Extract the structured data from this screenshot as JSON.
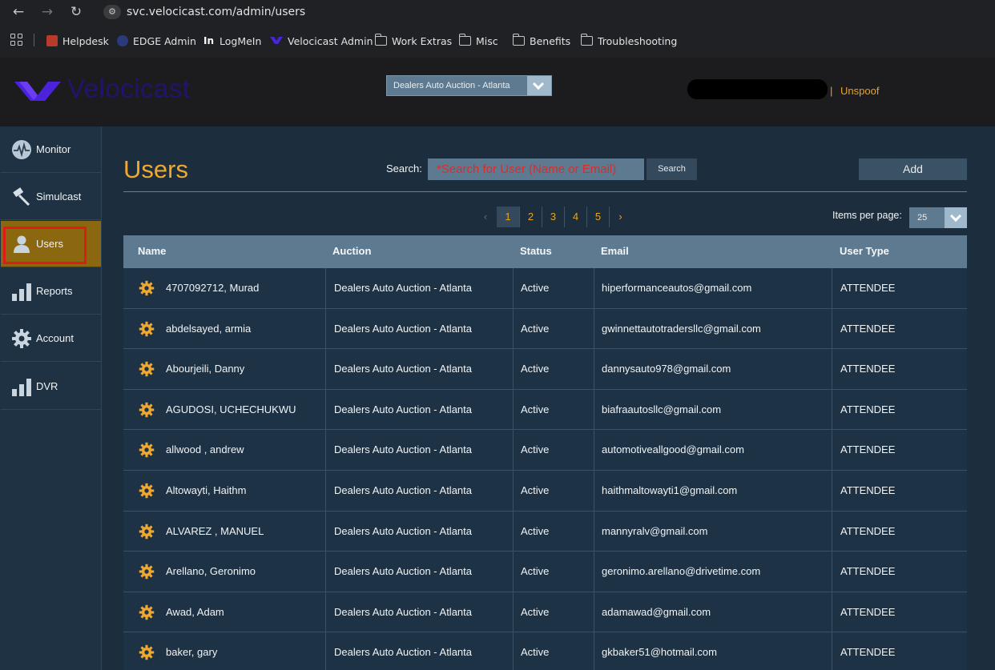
{
  "browser": {
    "url": "svc.velocicast.com/admin/users",
    "bookmarks": [
      {
        "label": "Helpdesk"
      },
      {
        "label": "EDGE Admin"
      },
      {
        "label": "LogMeIn"
      },
      {
        "label": "Velocicast Admin"
      },
      {
        "label": "Work Extras"
      },
      {
        "label": "Misc"
      },
      {
        "label": "Benefits"
      },
      {
        "label": "Troubleshooting"
      }
    ]
  },
  "header": {
    "logo_text": "Velocicast",
    "auction_selected": "Dealers Auto Auction - Atlanta",
    "separator": "|",
    "unspoof_label": "Unspoof"
  },
  "sidebar": {
    "items": [
      {
        "label": "Monitor",
        "icon": "monitor-icon"
      },
      {
        "label": "Simulcast",
        "icon": "gavel-icon"
      },
      {
        "label": "Users",
        "icon": "user-icon",
        "active": true
      },
      {
        "label": "Reports",
        "icon": "bar-chart-icon"
      },
      {
        "label": "Account",
        "icon": "gear-icon"
      },
      {
        "label": "DVR",
        "icon": "bar-chart-icon"
      }
    ]
  },
  "main": {
    "title": "Users",
    "search_label": "Search:",
    "search_placeholder": "*Search for User (Name or Email)",
    "search_button": "Search",
    "add_button": "Add",
    "pagination": {
      "prev": "‹",
      "pages": [
        "1",
        "2",
        "3",
        "4",
        "5"
      ],
      "current": "1",
      "next": "›"
    },
    "items_per_page_label": "Items per page:",
    "items_per_page_value": "25"
  },
  "table": {
    "columns": [
      "Name",
      "Auction",
      "Status",
      "Email",
      "User Type"
    ],
    "rows": [
      {
        "name": "4707092712, Murad",
        "auction": "Dealers Auto Auction - Atlanta",
        "status": "Active",
        "email": "hiperformanceautos@gmail.com",
        "type": "ATTENDEE"
      },
      {
        "name": "abdelsayed, armia",
        "auction": "Dealers Auto Auction - Atlanta",
        "status": "Active",
        "email": "gwinnettautotradersllc@gmail.com",
        "type": "ATTENDEE"
      },
      {
        "name": "Abourjeili, Danny",
        "auction": "Dealers Auto Auction - Atlanta",
        "status": "Active",
        "email": "dannysauto978@gmail.com",
        "type": "ATTENDEE"
      },
      {
        "name": "AGUDOSI, UCHECHUKWU",
        "auction": "Dealers Auto Auction - Atlanta",
        "status": "Active",
        "email": "biafraautosllc@gmail.com",
        "type": "ATTENDEE"
      },
      {
        "name": "allwood , andrew",
        "auction": "Dealers Auto Auction - Atlanta",
        "status": "Active",
        "email": "automotiveallgood@gmail.com",
        "type": "ATTENDEE"
      },
      {
        "name": "Altowayti, Haithm",
        "auction": "Dealers Auto Auction - Atlanta",
        "status": "Active",
        "email": "haithmaltowayti1@gmail.com",
        "type": "ATTENDEE"
      },
      {
        "name": "ALVAREZ , MANUEL",
        "auction": "Dealers Auto Auction - Atlanta",
        "status": "Active",
        "email": "mannyralv@gmail.com",
        "type": "ATTENDEE"
      },
      {
        "name": "Arellano, Geronimo",
        "auction": "Dealers Auto Auction - Atlanta",
        "status": "Active",
        "email": "geronimo.arellano@drivetime.com",
        "type": "ATTENDEE"
      },
      {
        "name": "Awad, Adam",
        "auction": "Dealers Auto Auction - Atlanta",
        "status": "Active",
        "email": "adamawad@gmail.com",
        "type": "ATTENDEE"
      },
      {
        "name": "baker, gary",
        "auction": "Dealers Auto Auction - Atlanta",
        "status": "Active",
        "email": "gkbaker51@hotmail.com",
        "type": "ATTENDEE"
      }
    ]
  },
  "colors": {
    "accent_orange": "#f0a830",
    "active_nav": "#8b6710",
    "table_header": "#5d7a90",
    "background": "#1d3244"
  }
}
